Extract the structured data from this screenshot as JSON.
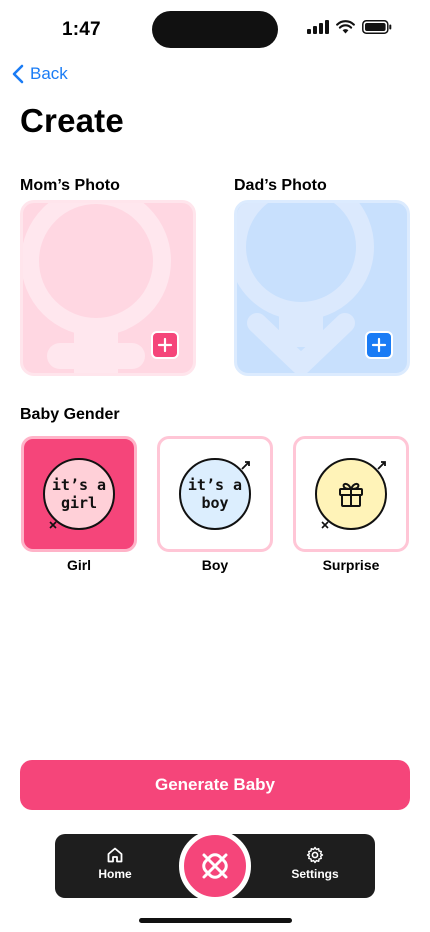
{
  "status_bar": {
    "time": "1:47",
    "icons": [
      "cellular-icon",
      "wifi-icon",
      "battery-icon"
    ]
  },
  "nav": {
    "back_label": "Back",
    "back_icon": "chevron-left-icon"
  },
  "page": {
    "title": "Create"
  },
  "photos": {
    "mom": {
      "label": "Mom’s Photo",
      "icon": "female-symbol-icon",
      "add_icon": "plus-icon"
    },
    "dad": {
      "label": "Dad’s Photo",
      "icon": "male-symbol-icon",
      "add_icon": "plus-icon"
    }
  },
  "baby_gender": {
    "label": "Baby Gender",
    "options": [
      {
        "caption": "Girl",
        "badge_line1": "it’s a",
        "badge_line2": "girl",
        "selected": true
      },
      {
        "caption": "Boy",
        "badge_line1": "it’s a",
        "badge_line2": "boy",
        "selected": false
      },
      {
        "caption": "Surprise",
        "icon": "gift-icon",
        "selected": false
      }
    ]
  },
  "generate_button": {
    "label": "Generate Baby"
  },
  "tab_bar": {
    "home": {
      "label": "Home",
      "icon": "home-icon"
    },
    "center": {
      "icon": "logo-icon"
    },
    "settings": {
      "label": "Settings",
      "icon": "gear-icon"
    }
  },
  "colors": {
    "accent_pink": "#f5457a",
    "accent_blue": "#1a7cf5",
    "mom_card": "#ffd7e2",
    "dad_card": "#c8e0fd",
    "tab_bar": "#1e1e1e"
  }
}
